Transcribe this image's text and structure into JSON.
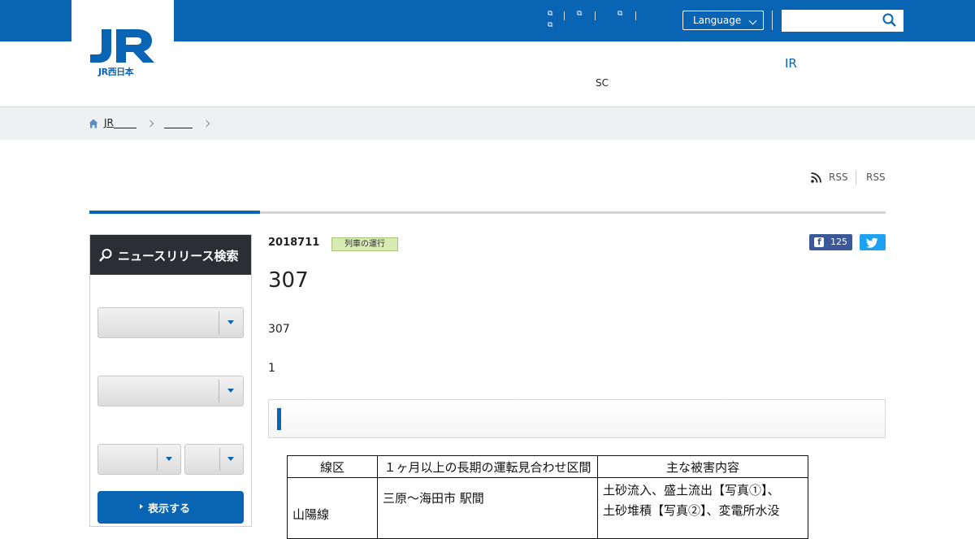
{
  "header": {
    "logo_text": "JR西日本",
    "ext_links": [
      "",
      "",
      "",
      ""
    ],
    "language_label": "Language",
    "search_placeholder": "",
    "nav_sc": "SC",
    "nav_ir": "IR"
  },
  "breadcrumb": {
    "items": [
      "JR",
      ""
    ]
  },
  "rss": {
    "link1": "RSS",
    "link2": "RSS"
  },
  "sidebar": {
    "title": "ニュースリリース検索",
    "select1_value": "",
    "select2_value": "",
    "select3a_value": "",
    "select3b_value": "",
    "submit_label": "表示する"
  },
  "article": {
    "date": "2018711",
    "category": "列車の運行",
    "facebook_count": "125",
    "title": "307",
    "para1": "307",
    "para2": "1",
    "section_heading": ""
  },
  "table": {
    "headers": [
      "線区",
      "１ヶ月以上の長期の運転見合わせ区間",
      "主な被害内容"
    ],
    "rows": [
      {
        "line": "山陽線",
        "section": "三原～海田市 駅間",
        "damage_1": "土砂流入、盛土流出【写真①】、",
        "damage_2": "土砂堆積【写真②】、変電所水没"
      }
    ]
  },
  "colors": {
    "brand_blue": "#0a64b4",
    "sidebar_head": "#2b2f33",
    "tag_green": "#d8ebb2",
    "facebook": "#3b5998",
    "twitter": "#1da1f2"
  }
}
